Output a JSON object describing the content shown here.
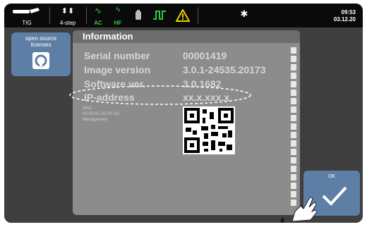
{
  "topbar": {
    "process": "TIG",
    "mode": "4-step",
    "ac_label": "AC",
    "hf_label": "HF",
    "time": "09:53",
    "date": "03.12.20",
    "icons": [
      "torch-icon",
      "4step-icon",
      "ac-icon",
      "hf-icon",
      "gas-icon",
      "pulse-icon",
      "warning-icon",
      "bluetooth-icon"
    ]
  },
  "left": {
    "license_button": "open source licenses"
  },
  "info": {
    "title": "Information",
    "rows": [
      {
        "label": "Serial number",
        "value": "00001419"
      },
      {
        "label": "Image version",
        "value": "3.0.1-24535.20173"
      },
      {
        "label": "Software ver.",
        "value": "3.0.1682"
      },
      {
        "label": "IP-address",
        "value": "xx.x.xxx.x"
      }
    ],
    "mac_label": "MAC",
    "mac_value": "00:03:AC:2C:0F:0A",
    "management": "Management"
  },
  "ok_button": {
    "label": "OK"
  },
  "callout": "4",
  "colors": {
    "button_blue": "#5e7fa5",
    "panel_gray": "#8c8c8c",
    "green": "#2ecc40",
    "warning": "#f0d000"
  }
}
